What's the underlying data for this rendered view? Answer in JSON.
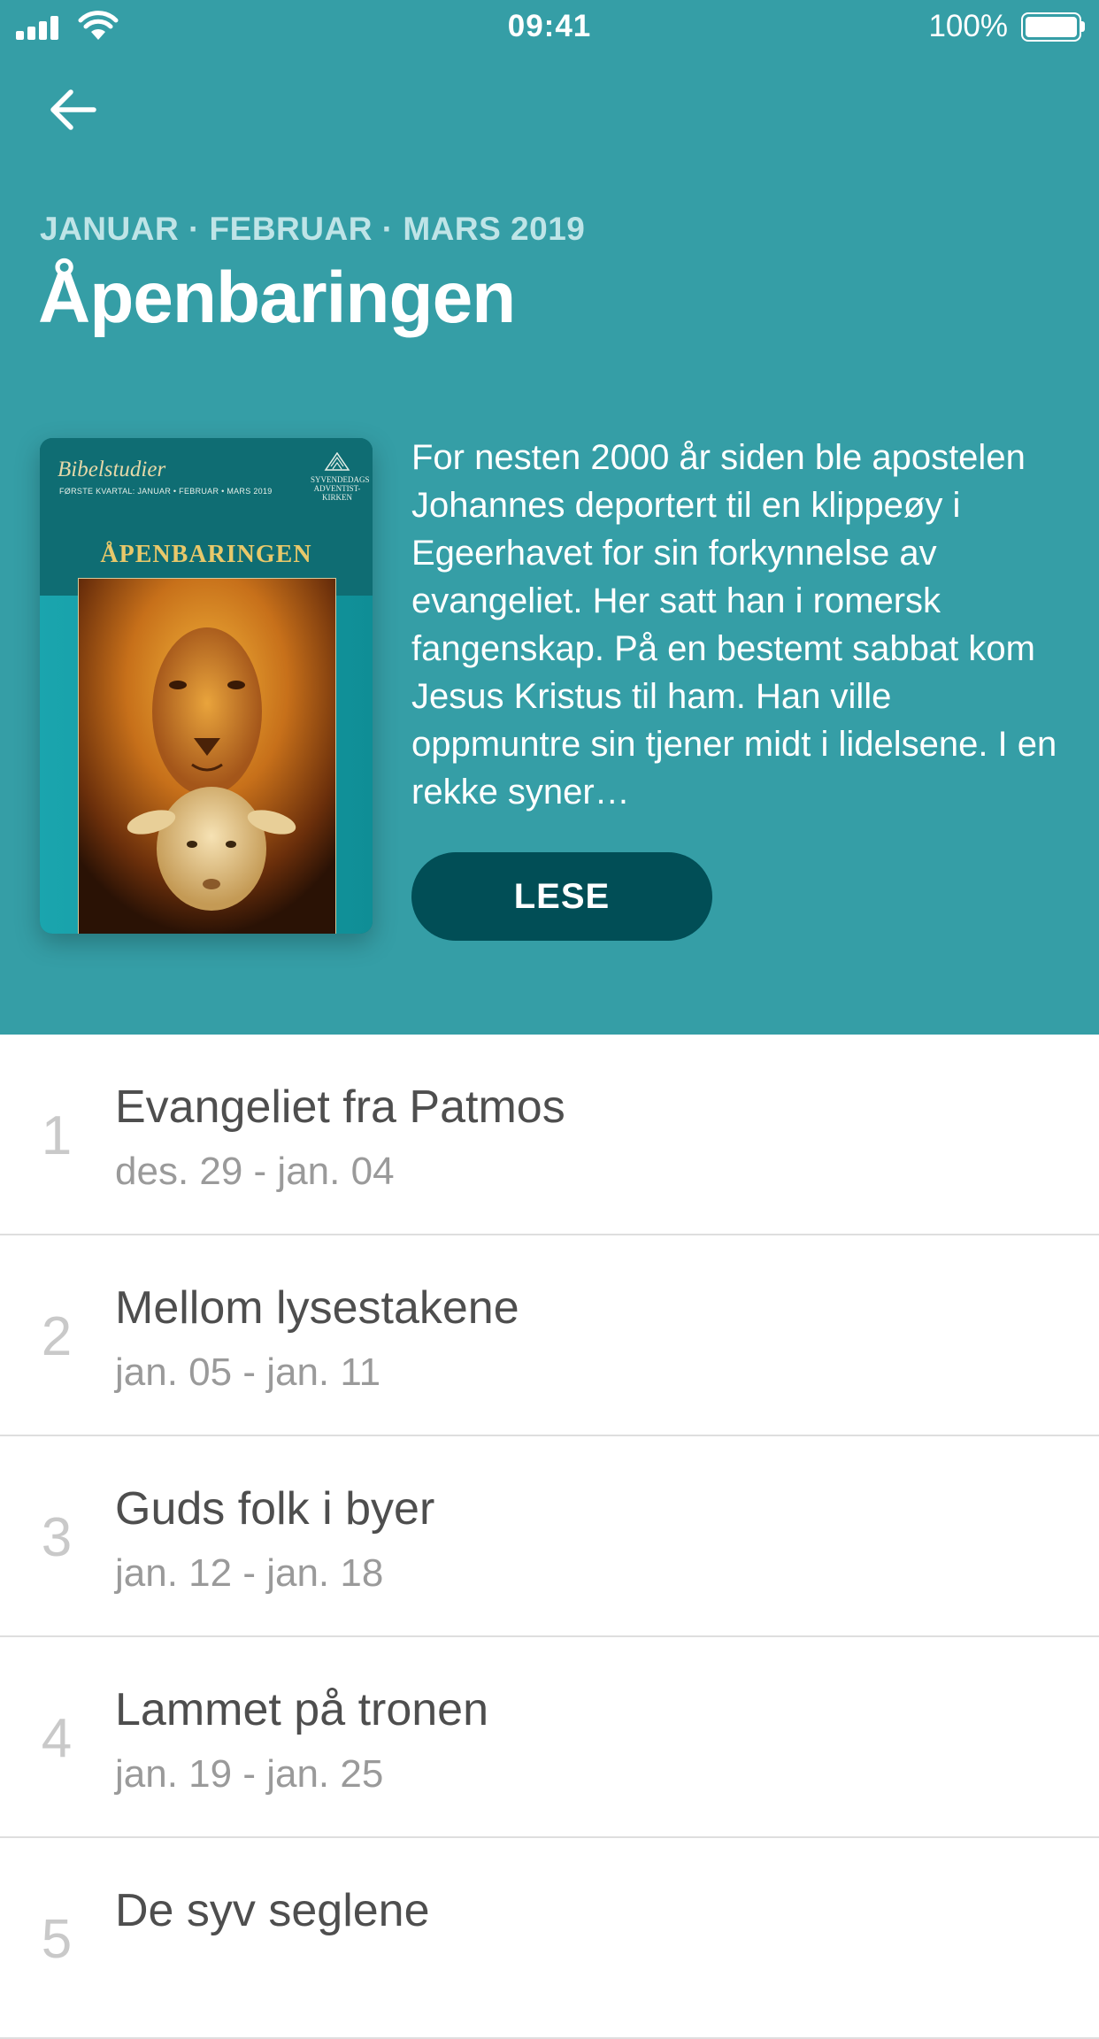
{
  "status_bar": {
    "time": "09:41",
    "battery": "100%"
  },
  "header": {
    "quarter": "JANUAR · FEBRUAR · MARS 2019",
    "title": "Åpenbaringen",
    "background": "#359ea6"
  },
  "cover": {
    "series": "Bibelstudier",
    "subline": "FØRSTE KVARTAL: JANUAR • FEBRUAR • MARS 2019",
    "church_lines": [
      "SYVENDEDAGS",
      "ADVENTIST-",
      "KIRKEN"
    ],
    "title": "ÅPENBARINGEN"
  },
  "description": "For nesten 2000 år siden ble apostelen Johannes deportert til en klippeøy i Egeerhavet for sin forkynnelse av evangeliet. Her satt han i romersk fangenskap. På en bestemt sabbat kom Jesus Kristus til ham. Han ville oppmuntre sin tjener midt i lidelsene. I en rekke syner…",
  "read_button": {
    "label": "LESE",
    "color": "#014e56"
  },
  "lessons": [
    {
      "number": "1",
      "title": "Evangeliet fra Patmos",
      "dates": "des. 29 - jan. 04"
    },
    {
      "number": "2",
      "title": "Mellom lysestakene",
      "dates": "jan. 05 - jan. 11"
    },
    {
      "number": "3",
      "title": "Guds folk i byer",
      "dates": "jan. 12 - jan. 18"
    },
    {
      "number": "4",
      "title": "Lammet på tronen",
      "dates": "jan. 19 - jan. 25"
    },
    {
      "number": "5",
      "title": "De syv seglene",
      "dates": ""
    }
  ]
}
